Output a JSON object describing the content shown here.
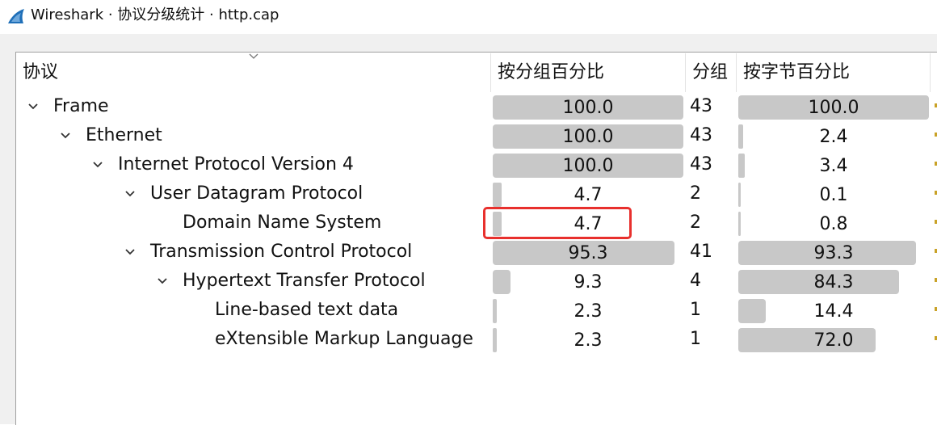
{
  "window": {
    "title": "Wireshark · 协议分级统计 · http.cap",
    "icon": "wireshark-fin-icon",
    "accent_color": "#1f6fb8"
  },
  "columns": {
    "protocol": "协议",
    "percent_packets": "按分组百分比",
    "packets": "分组",
    "percent_bytes": "按字节百分比"
  },
  "rows": [
    {
      "name": "Frame",
      "level": 0,
      "expanded": true,
      "percent_packets": "100.0",
      "packets": "43",
      "percent_bytes": "100.0"
    },
    {
      "name": "Ethernet",
      "level": 1,
      "expanded": true,
      "percent_packets": "100.0",
      "packets": "43",
      "percent_bytes": "2.4"
    },
    {
      "name": "Internet Protocol Version 4",
      "level": 2,
      "expanded": true,
      "percent_packets": "100.0",
      "packets": "43",
      "percent_bytes": "3.4"
    },
    {
      "name": "User Datagram Protocol",
      "level": 3,
      "expanded": true,
      "percent_packets": "4.7",
      "packets": "2",
      "percent_bytes": "0.1"
    },
    {
      "name": "Domain Name System",
      "level": 4,
      "expanded": null,
      "percent_packets": "4.7",
      "packets": "2",
      "percent_bytes": "0.8"
    },
    {
      "name": "Transmission Control Protocol",
      "level": 3,
      "expanded": true,
      "percent_packets": "95.3",
      "packets": "41",
      "percent_bytes": "93.3"
    },
    {
      "name": "Hypertext Transfer Protocol",
      "level": 4,
      "expanded": true,
      "percent_packets": "9.3",
      "packets": "4",
      "percent_bytes": "84.3"
    },
    {
      "name": "Line-based text data",
      "level": 5,
      "expanded": null,
      "percent_packets": "2.3",
      "packets": "1",
      "percent_bytes": "14.4"
    },
    {
      "name": "eXtensible Markup Language",
      "level": 5,
      "expanded": null,
      "percent_packets": "2.3",
      "packets": "1",
      "percent_bytes": "72.0"
    }
  ],
  "highlight": {
    "row": "Domain Name System",
    "column": "percent_packets",
    "color": "#e8302d"
  },
  "colors": {
    "bar": "#c8c8c8",
    "header_separator": "#e3e3e3"
  }
}
